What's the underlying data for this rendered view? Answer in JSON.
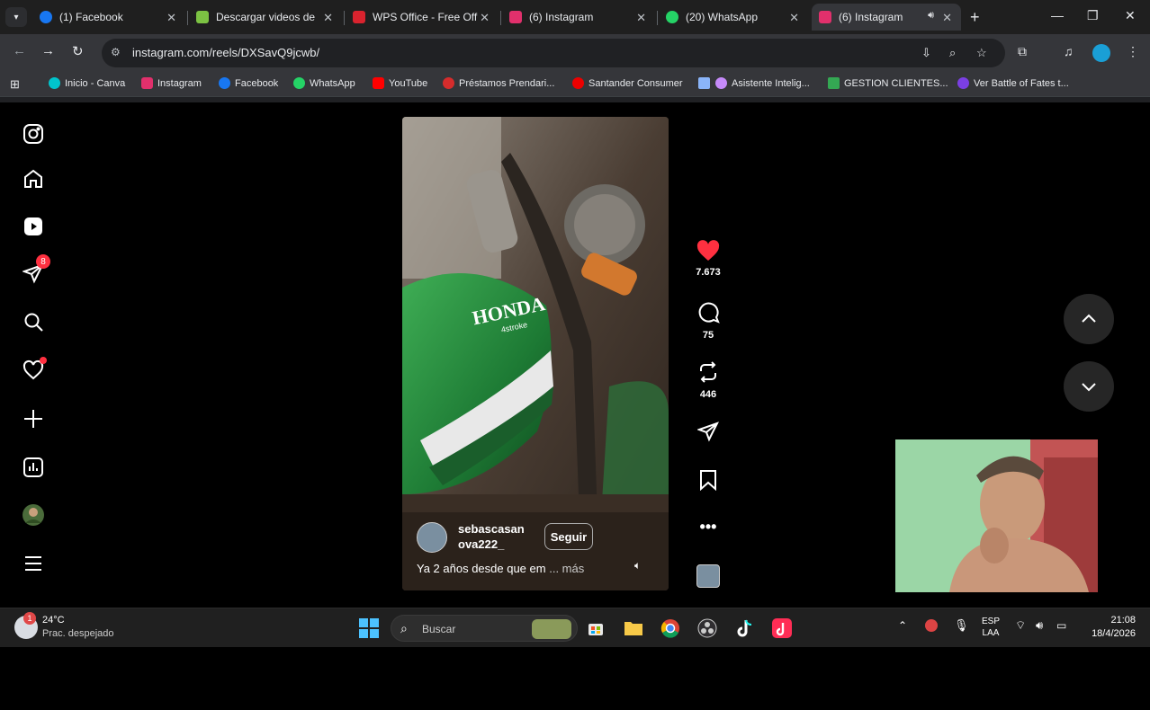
{
  "browser": {
    "tabs": [
      {
        "title": "(1) Facebook",
        "icon": "facebook-icon",
        "color": "#1877f2"
      },
      {
        "title": "Descargar videos de",
        "icon": "download-icon",
        "color": "#7cc243"
      },
      {
        "title": "WPS Office - Free Off",
        "icon": "wps-icon",
        "color": "#d9232e"
      },
      {
        "title": "(6) Instagram",
        "icon": "instagram-icon",
        "color": "#e1306c"
      },
      {
        "title": "(20) WhatsApp",
        "icon": "whatsapp-icon",
        "color": "#25d366"
      },
      {
        "title": "(6) Instagram",
        "icon": "instagram-icon",
        "color": "#e1306c",
        "active": true
      }
    ],
    "url": "instagram.com/reels/DXSavQ9jcwb/",
    "bookmarks": [
      {
        "label": "Inicio - Canva",
        "color": "#00c4cc"
      },
      {
        "label": "Instagram",
        "color": "#e1306c"
      },
      {
        "label": "Facebook",
        "color": "#1877f2"
      },
      {
        "label": "WhatsApp",
        "color": "#25d366"
      },
      {
        "label": "YouTube",
        "color": "#ff0000"
      },
      {
        "label": "Préstamos Prendari...",
        "color": "#d62c2c"
      },
      {
        "label": "Santander Consumer",
        "color": "#ec0000"
      },
      {
        "label": "",
        "color": "#8ab4f8"
      },
      {
        "label": "Asistente Intelig...",
        "color": "#c58af9"
      },
      {
        "label": "GESTION CLIENTES...",
        "color": "#34a853"
      },
      {
        "label": "Ver Battle of Fates t...",
        "color": "#7b3fe4"
      }
    ]
  },
  "sidebar": {
    "notifications_badge": "8"
  },
  "reel": {
    "username_line1": "sebascasan",
    "username_line2": "ova222_",
    "follow_label": "Seguir",
    "caption": "Ya 2 años desde que em",
    "more_label": "... más",
    "brand_text": "HONDA",
    "brand_sub": "4stroke",
    "likes": "7.673",
    "comments": "75",
    "reposts": "446",
    "accent": "#ff3040"
  },
  "taskbar": {
    "weather_temp": "24°C",
    "weather_desc": "Prac. despejado",
    "weather_badge": "1",
    "search_label": "Buscar",
    "lang_line1": "ESP",
    "lang_line2": "LAA",
    "time": "21:08",
    "date": "18/4/2026"
  }
}
